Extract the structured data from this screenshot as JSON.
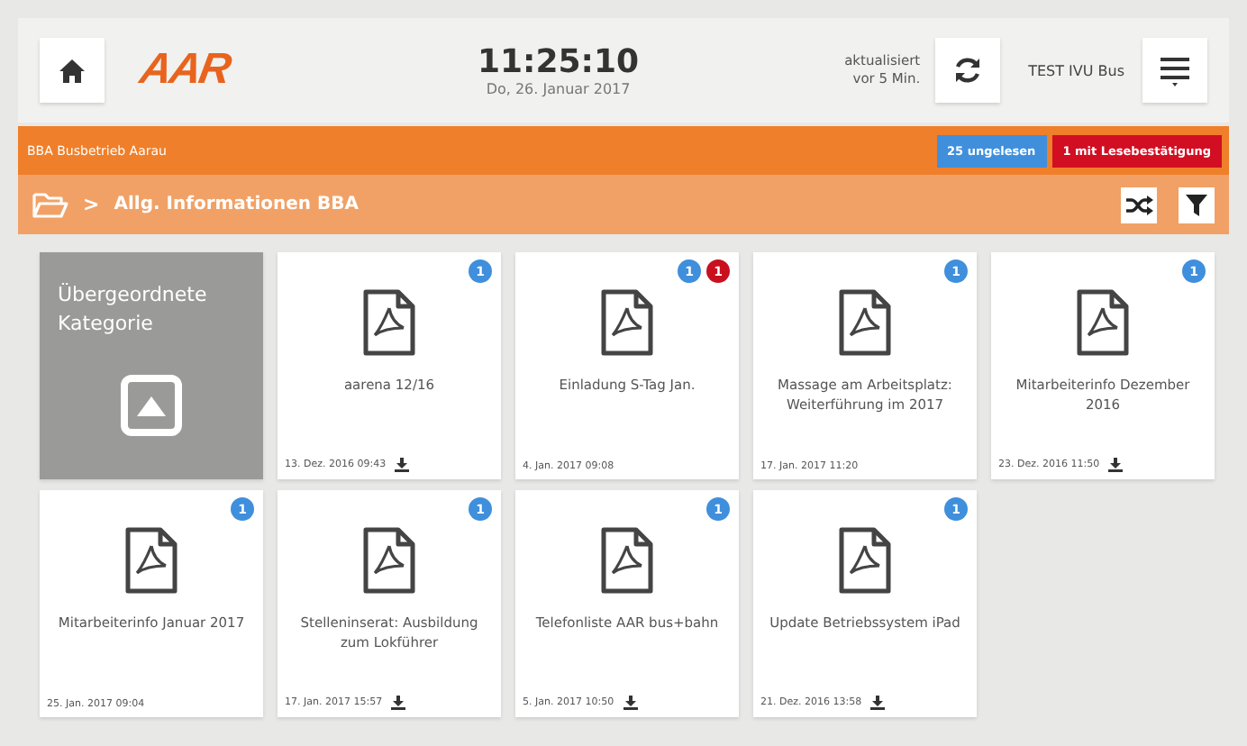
{
  "header": {
    "logo": "AAR",
    "time": "11:25:10",
    "date": "Do, 26. Januar 2017",
    "updated_line1": "aktualisiert",
    "updated_line2": "vor 5 Min.",
    "user": "TEST IVU Bus"
  },
  "org_bar": {
    "title": "BBA Busbetrieb Aarau",
    "unread_badge": "25 ungelesen",
    "confirm_badge": "1 mit Lesebestätigung"
  },
  "breadcrumb": {
    "separator": ">",
    "current": "Allg. Informationen BBA"
  },
  "tiles": [
    {
      "kind": "parent",
      "title": "Übergeordnete Kategorie"
    },
    {
      "kind": "document",
      "title": "aarena 12/16",
      "date": "13. Dez. 2016 09:43",
      "downloaded": true,
      "unread": "1"
    },
    {
      "kind": "document",
      "title": "Einladung S-Tag Jan.",
      "date": "4. Jan. 2017 09:08",
      "downloaded": false,
      "unread": "1",
      "confirm": "1"
    },
    {
      "kind": "document",
      "title": "Massage am Arbeitsplatz: Weiterführung im 2017",
      "date": "17. Jan. 2017 11:20",
      "downloaded": false,
      "unread": "1"
    },
    {
      "kind": "document",
      "title": "Mitarbeiterinfo Dezember 2016",
      "date": "23. Dez. 2016 11:50",
      "downloaded": true,
      "unread": "1"
    },
    {
      "kind": "document",
      "title": "Mitarbeiterinfo Januar 2017",
      "date": "25. Jan. 2017 09:04",
      "downloaded": false,
      "unread": "1"
    },
    {
      "kind": "document",
      "title": "Stelleninserat: Ausbildung zum Lokführer",
      "date": "17. Jan. 2017 15:57",
      "downloaded": true,
      "unread": "1"
    },
    {
      "kind": "document",
      "title": "Telefonliste AAR bus+bahn",
      "date": "5. Jan. 2017 10:50",
      "downloaded": true,
      "unread": "1"
    },
    {
      "kind": "document",
      "title": "Update Betriebssystem iPad",
      "date": "21. Dez. 2016 13:58",
      "downloaded": true,
      "unread": "1"
    }
  ]
}
